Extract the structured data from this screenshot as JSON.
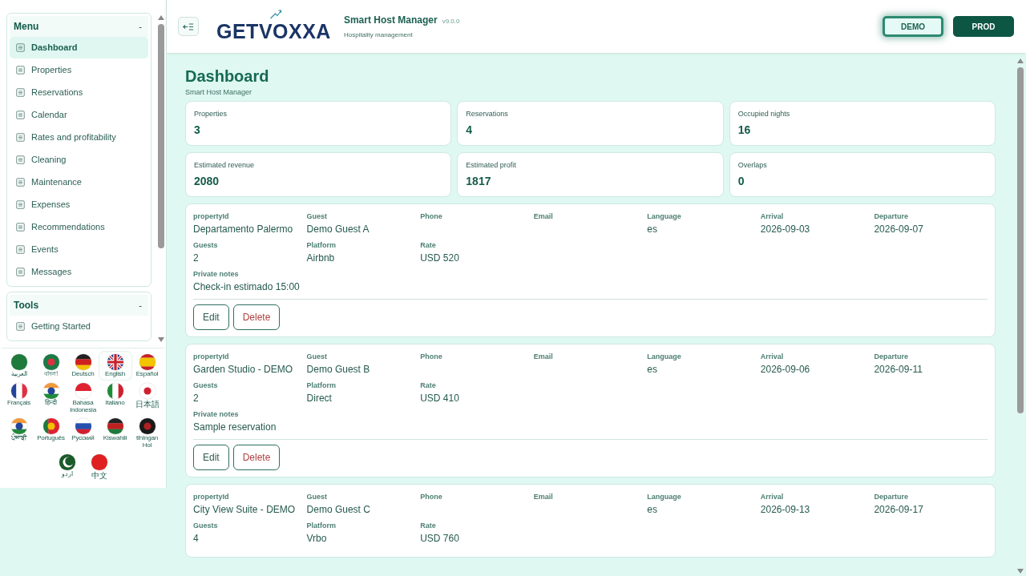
{
  "sidebar": {
    "sections": [
      {
        "title": "Menu",
        "toggle": "-",
        "items": [
          {
            "label": "Dashboard",
            "selected": true
          },
          {
            "label": "Properties",
            "selected": false
          },
          {
            "label": "Reservations",
            "selected": false
          },
          {
            "label": "Calendar",
            "selected": false
          },
          {
            "label": "Rates and profitability",
            "selected": false
          },
          {
            "label": "Cleaning",
            "selected": false
          },
          {
            "label": "Maintenance",
            "selected": false
          },
          {
            "label": "Expenses",
            "selected": false
          },
          {
            "label": "Recommendations",
            "selected": false
          },
          {
            "label": "Events",
            "selected": false
          },
          {
            "label": "Messages",
            "selected": false
          }
        ]
      },
      {
        "title": "Tools",
        "toggle": "-",
        "items": [
          {
            "label": "Getting Started",
            "selected": false
          }
        ]
      }
    ]
  },
  "languages": [
    {
      "label": "العربية",
      "kind": "sa",
      "selected": false
    },
    {
      "label": "বাংলা",
      "kind": "bd",
      "selected": false
    },
    {
      "label": "Deutsch",
      "kind": "de",
      "selected": false
    },
    {
      "label": "English",
      "kind": "gb",
      "selected": true
    },
    {
      "label": "Español",
      "kind": "es",
      "selected": false
    },
    {
      "label": "Français",
      "kind": "fr",
      "selected": false
    },
    {
      "label": "हिन्दी",
      "kind": "in",
      "selected": false
    },
    {
      "label": "Bahasa Indonesia",
      "kind": "id",
      "selected": false
    },
    {
      "label": "Italiano",
      "kind": "it",
      "selected": false
    },
    {
      "label": "日本語",
      "kind": "jp",
      "selected": false
    },
    {
      "label": "ਪੰਜਾਬੀ",
      "kind": "in",
      "selected": false
    },
    {
      "label": "Português",
      "kind": "pt",
      "selected": false
    },
    {
      "label": "Русский",
      "kind": "ru",
      "selected": false
    },
    {
      "label": "Kiswahili",
      "kind": "ke",
      "selected": false
    },
    {
      "label": "tlhIngan Hol",
      "kind": "kl",
      "selected": false
    },
    {
      "label": "اردو",
      "kind": "pk",
      "selected": false
    },
    {
      "label": "中文",
      "kind": "cn",
      "selected": false
    }
  ],
  "header": {
    "logo": "GETVOXXA",
    "app_name": "Smart Host Manager",
    "version": "v9.0.0",
    "subtitle": "Hospitality management",
    "modes": [
      {
        "label": "DEMO",
        "selected": true
      },
      {
        "label": "PROD",
        "selected": false
      }
    ]
  },
  "page": {
    "title": "Dashboard",
    "subtitle": "Smart Host Manager"
  },
  "stats": [
    {
      "label": "Properties",
      "value": "3"
    },
    {
      "label": "Reservations",
      "value": "4"
    },
    {
      "label": "Occupied nights",
      "value": "16"
    },
    {
      "label": "Estimated revenue",
      "value": "2080"
    },
    {
      "label": "Estimated profit",
      "value": "1817"
    },
    {
      "label": "Overlaps",
      "value": "0"
    }
  ],
  "reservations": [
    {
      "rows": [
        [
          {
            "label": "propertyId",
            "value": "Departamento Palermo"
          },
          {
            "label": "Guest",
            "value": "Demo Guest A"
          },
          {
            "label": "Phone"
          },
          {
            "label": "Email"
          },
          {
            "label": "Language",
            "value": "es"
          },
          {
            "label": "Arrival",
            "value": "2026-09-03"
          },
          {
            "label": "Departure",
            "value": "2026-09-07"
          }
        ],
        [
          {
            "label": "Guests",
            "value": "2"
          },
          {
            "label": "Platform",
            "value": "Airbnb"
          },
          {
            "label": "Rate",
            "value": "USD 520"
          }
        ],
        [
          {
            "label": "Private notes",
            "value": "Check-in estimado 15:00"
          }
        ]
      ],
      "actions": [
        "Edit",
        "Delete"
      ]
    },
    {
      "rows": [
        [
          {
            "label": "propertyId",
            "value": "Garden Studio - DEMO"
          },
          {
            "label": "Guest",
            "value": "Demo Guest B"
          },
          {
            "label": "Phone"
          },
          {
            "label": "Email"
          },
          {
            "label": "Language",
            "value": "es"
          },
          {
            "label": "Arrival",
            "value": "2026-09-06"
          },
          {
            "label": "Departure",
            "value": "2026-09-11"
          }
        ],
        [
          {
            "label": "Guests",
            "value": "2"
          },
          {
            "label": "Platform",
            "value": "Direct"
          },
          {
            "label": "Rate",
            "value": "USD 410"
          }
        ],
        [
          {
            "label": "Private notes",
            "value": "Sample reservation"
          }
        ]
      ],
      "actions": [
        "Edit",
        "Delete"
      ]
    },
    {
      "rows": [
        [
          {
            "label": "propertyId",
            "value": "City View Suite - DEMO"
          },
          {
            "label": "Guest",
            "value": "Demo Guest C"
          },
          {
            "label": "Phone"
          },
          {
            "label": "Email"
          },
          {
            "label": "Language",
            "value": "es"
          },
          {
            "label": "Arrival",
            "value": "2026-09-13"
          },
          {
            "label": "Departure",
            "value": "2026-09-17"
          }
        ],
        [
          {
            "label": "Guests",
            "value": "4"
          },
          {
            "label": "Platform",
            "value": "Vrbo"
          },
          {
            "label": "Rate",
            "value": "USD 760"
          }
        ]
      ]
    }
  ]
}
